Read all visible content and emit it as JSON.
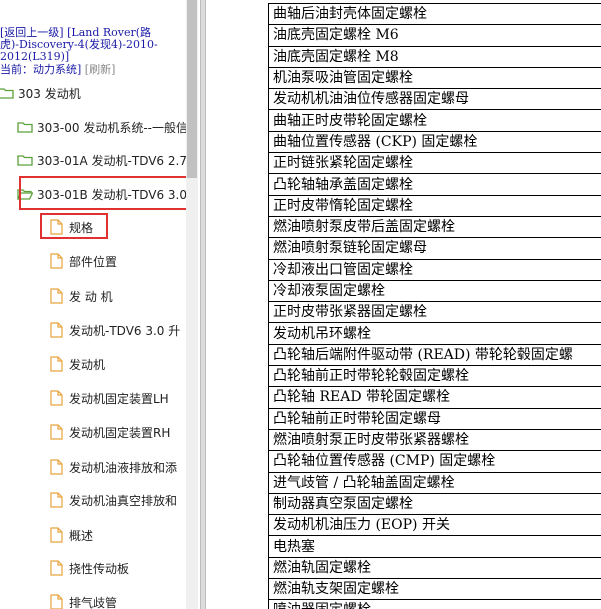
{
  "breadcrumb": {
    "back_link": "[返回上一级]",
    "model_line1": "[Land Rover(路",
    "model_line2": "虎)-Discovery-4(发现4)-2010-",
    "model_line3": "2012(L319)]",
    "current_prefix": "当前：",
    "current_value": "动力系统]",
    "refresh": "[刷新]"
  },
  "tree": {
    "root": "303 发动机",
    "sections": [
      {
        "label": "303-00 发动机系统--一般信"
      },
      {
        "label": "303-01A 发动机-TDV6 2.7"
      },
      {
        "label": "303-01B 发动机-TDV6 3.0"
      }
    ],
    "items": [
      "规格",
      "部件位置",
      "发 动 机",
      "发动机-TDV6 3.0 升",
      "发动机",
      "发动机固定装置LH",
      "发动机固定装置RH",
      "发动机油液排放和添",
      "发动机油真空排放和",
      "概述",
      "挠性传动板",
      "排气歧管"
    ]
  },
  "spec_table": {
    "rows": [
      "曲轴后油封壳体固定螺栓",
      "油底壳固定螺栓 M6",
      "油底壳固定螺栓 M8",
      "机油泵吸油管固定螺栓",
      "发动机机油油位传感器固定螺母",
      "曲轴正时皮带轮固定螺栓",
      "曲轴位置传感器 (CKP) 固定螺栓",
      "正时链张紧轮固定螺栓",
      "凸轮轴轴承盖固定螺栓",
      "正时皮带惰轮固定螺栓",
      "燃油喷射泵皮带后盖固定螺栓",
      "燃油喷射泵链轮固定螺母",
      "冷却液出口管固定螺栓",
      "冷却液泵固定螺栓",
      "正时皮带张紧器固定螺栓",
      "发动机吊环螺栓",
      "凸轮轴后端附件驱动带 (READ) 带轮轮毂固定螺",
      "凸轮轴前正时带轮轮毂固定螺栓",
      "凸轮轴 READ 带轮固定螺栓",
      "凸轮轴前正时带轮固定螺母",
      "燃油喷射泵正时皮带张紧器螺栓",
      "凸轮轴位置传感器 (CMP) 固定螺栓",
      "进气歧管 / 凸轮轴盖固定螺栓",
      "制动器真空泵固定螺栓",
      "发动机机油压力 (EOP) 开关",
      "电热塞",
      "燃油轨固定螺栓",
      "燃油轨支架固定螺栓",
      "喷油器固定螺栓"
    ]
  },
  "colors": {
    "link": "#1a1aa6",
    "highlight": "#e03030",
    "folder_green": "#5ba13a",
    "doc_orange": "#e8a33d"
  }
}
